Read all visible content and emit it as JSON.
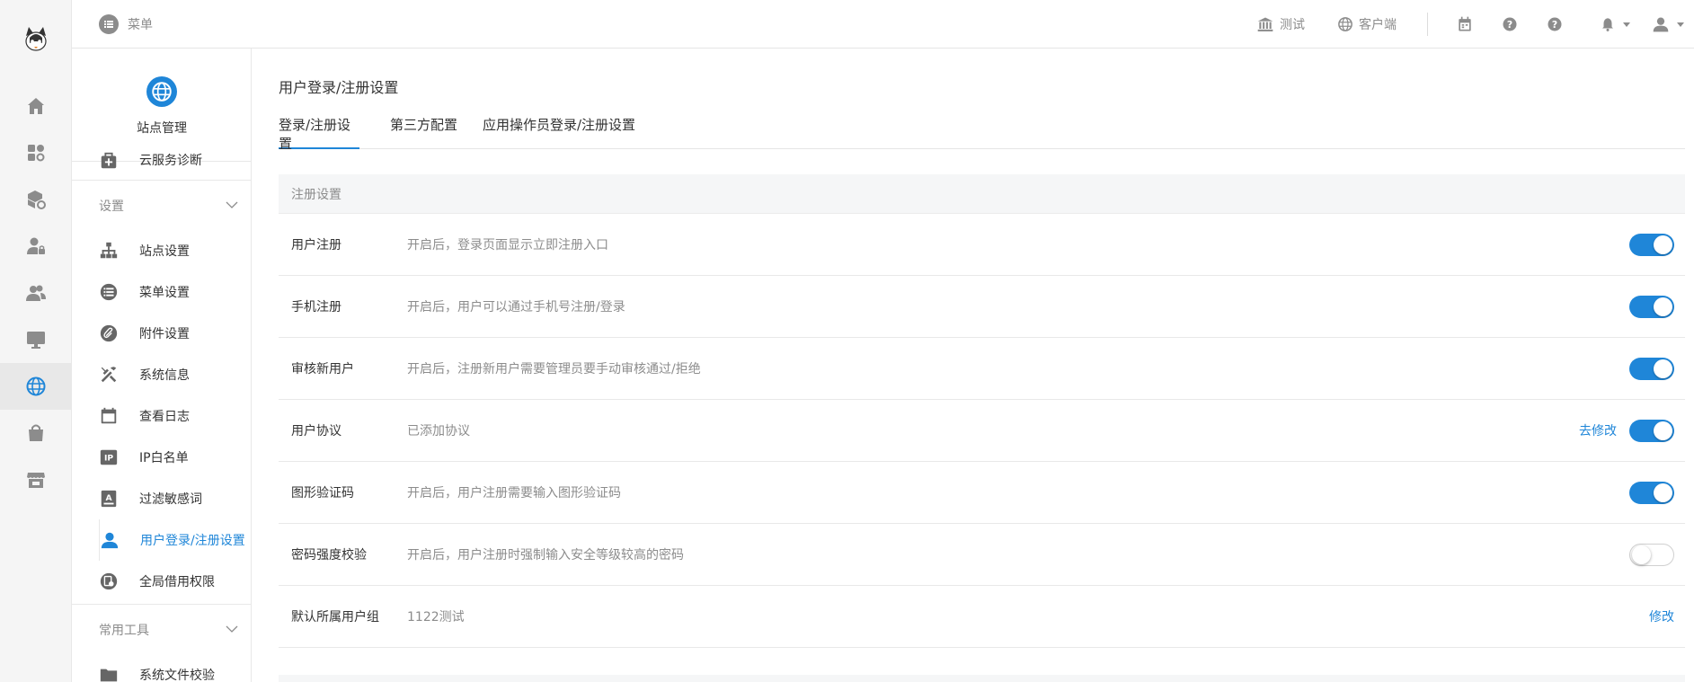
{
  "topbar": {
    "menu_label": "菜单",
    "items": [
      {
        "label": "测试",
        "icon": "bank-icon"
      },
      {
        "label": "客户端",
        "icon": "globe-icon"
      }
    ],
    "icons": [
      "calendar-icon",
      "help-icon",
      "help-icon",
      "bell-icon",
      "user-icon"
    ]
  },
  "rail": {
    "logo": "logo-image",
    "items": [
      "home-icon",
      "apps-icon",
      "cube-gear-icon",
      "user-lock-icon",
      "users-icon",
      "monitor-icon",
      "globe-icon",
      "bag-icon",
      "store-icon"
    ],
    "active_index": 6
  },
  "sidebar": {
    "title": "站点管理",
    "top_item": "云服务诊断",
    "groups": [
      {
        "label": "设置",
        "items": [
          "站点设置",
          "菜单设置",
          "附件设置",
          "系统信息",
          "查看日志",
          "IP白名单",
          "过滤敏感词",
          "用户登录/注册设置",
          "全局借用权限"
        ]
      },
      {
        "label": "常用工具",
        "items": [
          "系统文件校验"
        ]
      }
    ],
    "active_item": "用户登录/注册设置"
  },
  "page": {
    "title": "用户登录/注册设置",
    "tabs": [
      "登录/注册设置",
      "第三方配置",
      "应用操作员登录/注册设置"
    ],
    "active_tab": 0,
    "section_title": "注册设置",
    "rows": [
      {
        "label": "用户注册",
        "desc": "开启后，登录页面显示立即注册入口",
        "enabled": true
      },
      {
        "label": "手机注册",
        "desc": "开启后，用户可以通过手机号注册/登录",
        "enabled": true
      },
      {
        "label": "审核新用户",
        "desc": "开启后，注册新用户需要管理员要手动审核通过/拒绝",
        "enabled": true
      },
      {
        "label": "用户协议",
        "desc": "已添加协议",
        "enabled": true,
        "link": "去修改"
      },
      {
        "label": "图形验证码",
        "desc": "开启后，用户注册需要输入图形验证码",
        "enabled": true
      },
      {
        "label": "密码强度校验",
        "desc": "开启后，用户注册时强制输入安全等级较高的密码",
        "enabled": false
      },
      {
        "label": "默认所属用户组",
        "desc": "1122测试",
        "link": "修改"
      }
    ]
  },
  "colors": {
    "accent": "#1f86d8",
    "muted": "#8c8c8c"
  }
}
